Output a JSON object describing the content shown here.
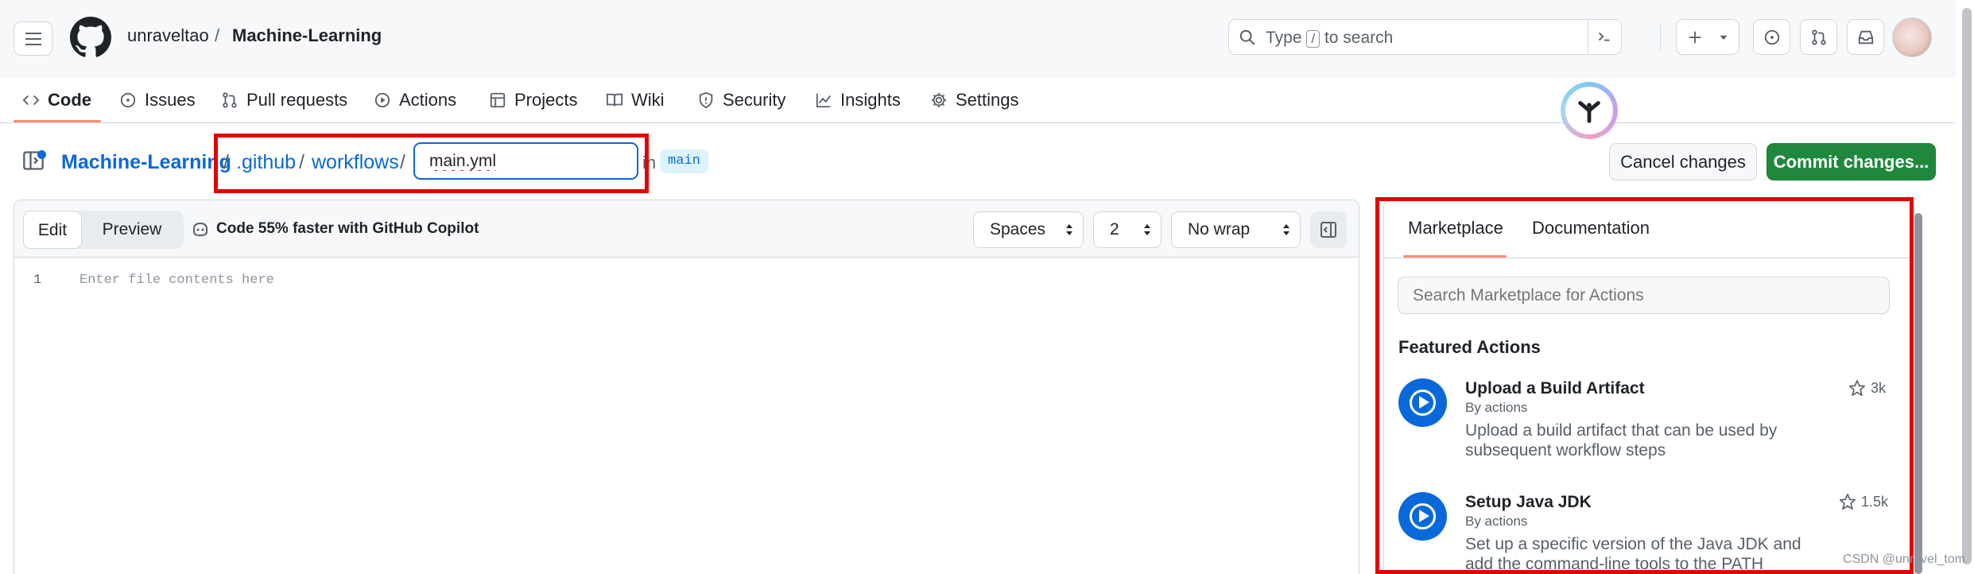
{
  "header": {
    "owner": "unraveltao",
    "separator": "/",
    "repo": "Machine-Learning",
    "search_prefix": "Type",
    "search_key": "/",
    "search_suffix": "to search"
  },
  "nav": {
    "items": [
      {
        "label": "Code",
        "icon": "code-icon"
      },
      {
        "label": "Issues",
        "icon": "issue-opened-icon"
      },
      {
        "label": "Pull requests",
        "icon": "git-pull-request-icon"
      },
      {
        "label": "Actions",
        "icon": "play-icon"
      },
      {
        "label": "Projects",
        "icon": "table-icon"
      },
      {
        "label": "Wiki",
        "icon": "book-icon"
      },
      {
        "label": "Security",
        "icon": "shield-icon"
      },
      {
        "label": "Insights",
        "icon": "graph-icon"
      },
      {
        "label": "Settings",
        "icon": "gear-icon"
      }
    ],
    "active": "Code"
  },
  "breadcrumb": {
    "repo": "Machine-Learning",
    "sep": "/",
    "dir1": ".github",
    "dir2": "workflows",
    "filename": "main.yml",
    "in_label": "in",
    "branch": "main"
  },
  "actions": {
    "cancel": "Cancel changes",
    "commit": "Commit changes..."
  },
  "editor": {
    "edit_tab": "Edit",
    "preview_tab": "Preview",
    "copilot_tip": "Code 55% faster with GitHub Copilot",
    "indent_mode": "Spaces",
    "indent_size": "2",
    "wrap_mode": "No wrap",
    "line_number": "1",
    "placeholder": "Enter file contents here"
  },
  "panel": {
    "tabs": [
      "Marketplace",
      "Documentation"
    ],
    "search_placeholder": "Search Marketplace for Actions",
    "featured_title": "Featured Actions",
    "actions": [
      {
        "name": "Upload a Build Artifact",
        "by": "By actions",
        "desc": "Upload a build artifact that can be used by subsequent workflow steps",
        "stars": "3k"
      },
      {
        "name": "Setup Java JDK",
        "by": "By actions",
        "desc": "Set up a specific version of the Java JDK and add the command-line tools to the PATH",
        "stars": "1.5k"
      }
    ]
  },
  "watermark": "CSDN @unravel_tom",
  "colors": {
    "accent_blue": "#0969da",
    "commit_green": "#1f883d",
    "annotation_red": "#e50000",
    "tab_underline": "#fd8c73"
  }
}
